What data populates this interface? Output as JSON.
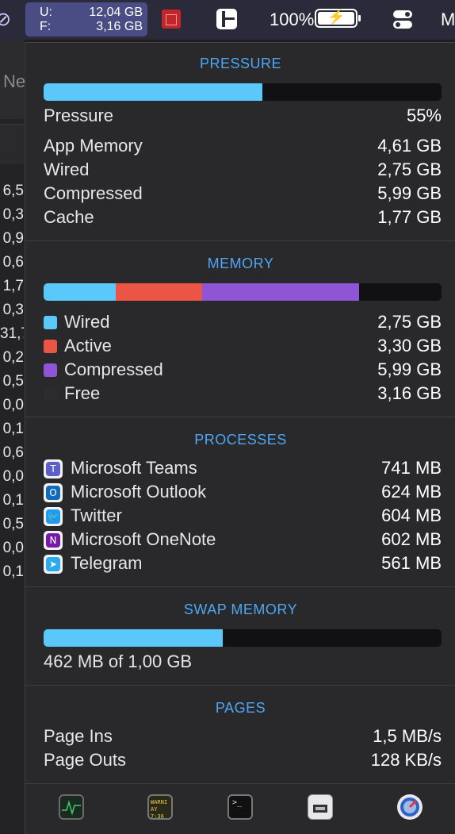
{
  "menubar": {
    "memory_used_key": "U:",
    "memory_used_value": "12,04 GB",
    "memory_free_key": "F:",
    "memory_free_value": "3,16 GB",
    "battery_percent": "100%",
    "trailing_letter": "M"
  },
  "background_window": {
    "column_header": "Ne",
    "cells": [
      "6,5",
      "0,3",
      "0,9",
      "0,6",
      "1,7",
      "0,3",
      "31,7",
      "0,2",
      "0,5",
      "0,0",
      "0,1",
      "0,6",
      "0,0",
      "0,1",
      "0,5",
      "0,0",
      "0,1"
    ]
  },
  "pressure": {
    "title": "PRESSURE",
    "level": 0.55,
    "color": "#5ac8fa",
    "rows": [
      {
        "label": "Pressure",
        "value": "55%"
      },
      {
        "label": "App Memory",
        "value": "4,61 GB"
      },
      {
        "label": "Wired",
        "value": "2,75 GB"
      },
      {
        "label": "Compressed",
        "value": "5,99 GB"
      },
      {
        "label": "Cache",
        "value": "1,77 GB"
      }
    ]
  },
  "memory": {
    "title": "MEMORY",
    "segments": [
      {
        "label": "Wired",
        "value": "2,75 GB",
        "gb": 2.75,
        "color": "#5ac8fa"
      },
      {
        "label": "Active",
        "value": "3,30 GB",
        "gb": 3.3,
        "color": "#eb5545"
      },
      {
        "label": "Compressed",
        "value": "5,99 GB",
        "gb": 5.99,
        "color": "#8e55d6"
      },
      {
        "label": "Free",
        "value": "3,16 GB",
        "gb": 3.16,
        "color": "#2c2c2e"
      }
    ]
  },
  "processes": {
    "title": "PROCESSES",
    "items": [
      {
        "name": "Microsoft Teams",
        "value": "741 MB",
        "icon": "teams-icon",
        "color": "#5b5fc7"
      },
      {
        "name": "Microsoft Outlook",
        "value": "624 MB",
        "icon": "outlook-icon",
        "color": "#0f6cbd"
      },
      {
        "name": "Twitter",
        "value": "604 MB",
        "icon": "twitter-icon",
        "color": "#1d9bf0"
      },
      {
        "name": "Microsoft OneNote",
        "value": "602 MB",
        "icon": "onenote-icon",
        "color": "#7719aa"
      },
      {
        "name": "Telegram",
        "value": "561 MB",
        "icon": "telegram-icon",
        "color": "#2aabee"
      }
    ]
  },
  "swap": {
    "title": "SWAP MEMORY",
    "level": 0.45,
    "text": "462 MB of 1,00 GB"
  },
  "pages": {
    "title": "PAGES",
    "rows": [
      {
        "label": "Page Ins",
        "value": "1,5 MB/s"
      },
      {
        "label": "Page Outs",
        "value": "128 KB/s"
      }
    ]
  },
  "dock": {
    "console_text_1": "WARNI",
    "console_text_2": "AY 7:36",
    "icons": [
      "activity-monitor-icon",
      "console-icon",
      "terminal-icon",
      "system-information-icon",
      "disk-utility-icon"
    ]
  }
}
